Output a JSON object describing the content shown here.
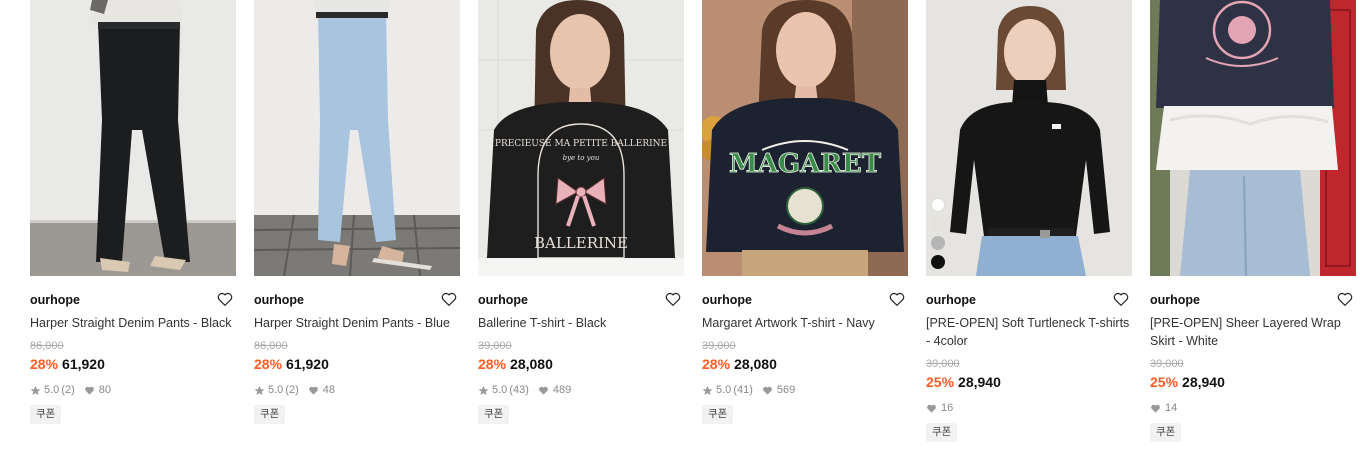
{
  "products": [
    {
      "brand": "ourhope",
      "name": "Harper Straight Denim Pants - Black",
      "original_price": "86,000",
      "discount": "28%",
      "price": "61,920",
      "rating": "5.0",
      "reviews": "(2)",
      "likes": "80",
      "coupon": "쿠폰",
      "image": "model wearing black straight denim pants"
    },
    {
      "brand": "ourhope",
      "name": "Harper Straight Denim Pants - Blue",
      "original_price": "86,000",
      "discount": "28%",
      "price": "61,920",
      "rating": "5.0",
      "reviews": "(2)",
      "likes": "48",
      "coupon": "쿠폰",
      "image": "model wearing light blue straight denim pants"
    },
    {
      "brand": "ourhope",
      "name": "Ballerine T-shirt - Black",
      "original_price": "39,000",
      "discount": "28%",
      "price": "28,080",
      "rating": "5.0",
      "reviews": "(43)",
      "likes": "489",
      "coupon": "쿠폰",
      "image": "model in black t-shirt with pink bow print",
      "print_top": "PRECIEUSE MA PETITE BALLERINE",
      "print_script": "bye to you",
      "print_bottom": "BALLERINE"
    },
    {
      "brand": "ourhope",
      "name": "Margaret Artwork T-shirt - Navy",
      "original_price": "39,000",
      "discount": "28%",
      "price": "28,080",
      "rating": "5.0",
      "reviews": "(41)",
      "likes": "569",
      "coupon": "쿠폰",
      "image": "model in navy t-shirt with green MAGARET print",
      "print_text": "MAGARET"
    },
    {
      "brand": "ourhope",
      "name": "[PRE-OPEN] Soft Turtleneck T-shirts - 4color",
      "original_price": "39,000",
      "discount": "25%",
      "price": "28,940",
      "likes": "16",
      "coupon": "쿠폰",
      "image": "model in black turtleneck with jeans",
      "swatches": [
        "#ffffff",
        "#e6e1da",
        "#b5b5b5",
        "#111111"
      ]
    },
    {
      "brand": "ourhope",
      "name": "[PRE-OPEN] Sheer Layered Wrap Skirt - White",
      "original_price": "39,000",
      "discount": "25%",
      "price": "28,940",
      "likes": "14",
      "coupon": "쿠폰",
      "image": "model in navy sweatshirt with white sheer layered skirt"
    }
  ],
  "colors": {
    "discount": "#ff5a1f",
    "muted": "#aaaaaa",
    "coupon_bg": "#f2f2f2"
  },
  "icons": {
    "like": "heart-outline-icon",
    "rating": "star-icon",
    "likes": "heart-filled-icon"
  }
}
